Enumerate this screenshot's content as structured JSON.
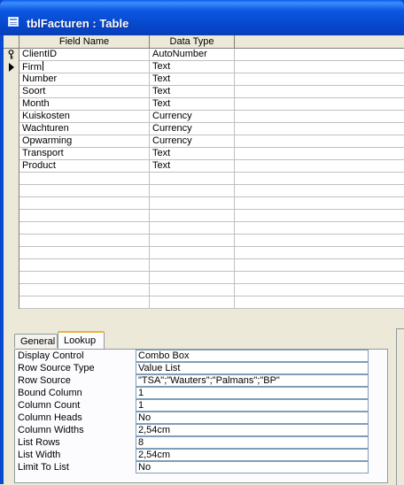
{
  "window": {
    "title": "tblFacturen : Table",
    "title_color": "#ffffff",
    "titlebar_color": "#0a4ad0"
  },
  "grid": {
    "headers": {
      "field_name": "Field Name",
      "data_type": "Data Type"
    },
    "rows": [
      {
        "name": "ClientID",
        "type": "AutoNumber",
        "marker": "key"
      },
      {
        "name": "Firm",
        "type": "Text",
        "marker": "current"
      },
      {
        "name": "Number",
        "type": "Text"
      },
      {
        "name": "Soort",
        "type": "Text"
      },
      {
        "name": "Month",
        "type": "Text"
      },
      {
        "name": "Kuiskosten",
        "type": "Currency"
      },
      {
        "name": "Wachturen",
        "type": "Currency"
      },
      {
        "name": "Opwarming",
        "type": "Currency"
      },
      {
        "name": "Transport",
        "type": "Text"
      },
      {
        "name": "Product",
        "type": "Text"
      }
    ]
  },
  "tabs": {
    "general": "General",
    "lookup": "Lookup",
    "active": "Lookup"
  },
  "lookup_properties": [
    {
      "label": "Display Control",
      "value": "Combo Box"
    },
    {
      "label": "Row Source Type",
      "value": "Value List"
    },
    {
      "label": "Row Source",
      "value": "\"TSA\";\"Wauters\";\"Palmans\";\"BP\""
    },
    {
      "label": "Bound Column",
      "value": "1"
    },
    {
      "label": "Column Count",
      "value": "1"
    },
    {
      "label": "Column Heads",
      "value": "No"
    },
    {
      "label": "Column Widths",
      "value": "2,54cm"
    },
    {
      "label": "List Rows",
      "value": "8"
    },
    {
      "label": "List Width",
      "value": "2,54cm"
    },
    {
      "label": "Limit To List",
      "value": "No"
    }
  ]
}
